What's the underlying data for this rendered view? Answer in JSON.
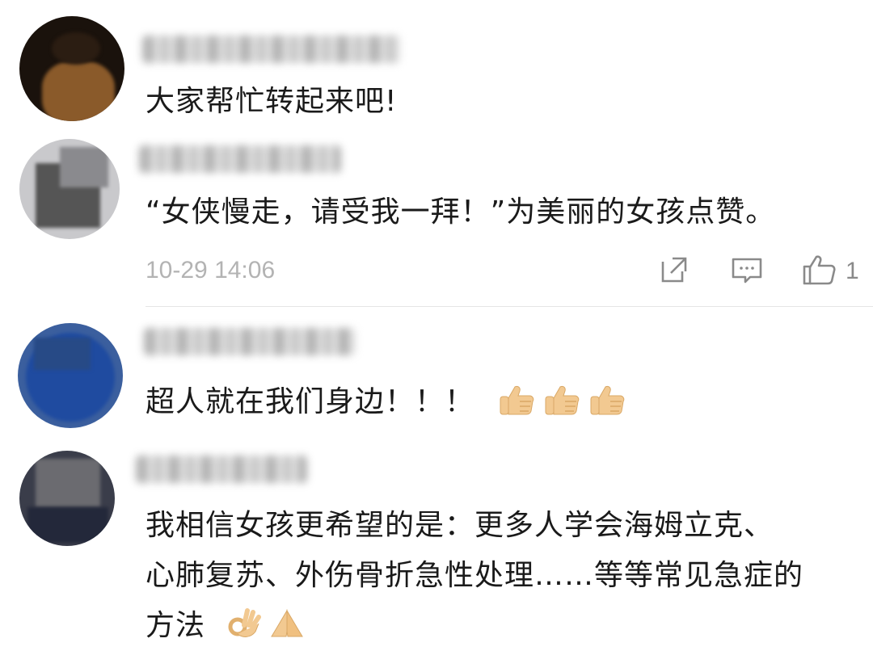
{
  "comments": [
    {
      "text": "大家帮忙转起来吧!"
    },
    {
      "text": "“女侠慢走，请受我一拜！”为美丽的女孩点赞。",
      "timestamp": "10-29 14:06",
      "like_count": "1"
    },
    {
      "text": "超人就在我们身边！！！"
    },
    {
      "lines": [
        "我相信女孩更希望的是：更多人学会海姆立克、",
        "心肺复苏、外伤骨折急性处理……等等常见急症的",
        "方法"
      ]
    }
  ],
  "icons": {
    "share": "share-icon",
    "reply": "comment-icon",
    "like": "thumbs-up-icon",
    "emoji_thumbs": "thumbs-up-emoji",
    "emoji_ok": "ok-hand-emoji",
    "emoji_pray": "pray-hands-emoji"
  },
  "colors": {
    "timestamp": "#b3b3b3",
    "icon": "#8a8a8a",
    "divider": "#e5e5e5",
    "emoji_skin": "#f2c991"
  }
}
